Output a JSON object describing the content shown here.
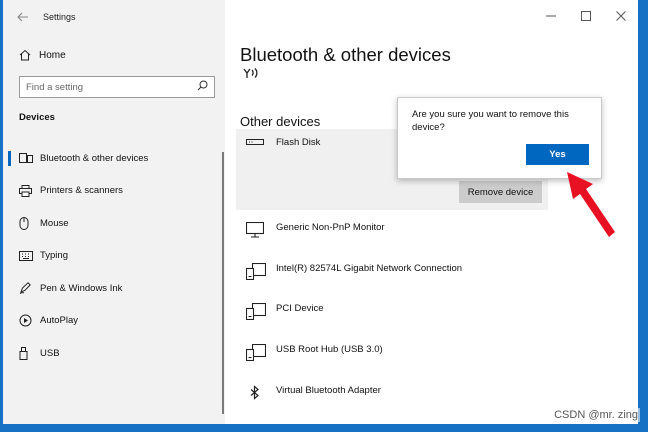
{
  "window": {
    "title": "Settings"
  },
  "sidebar": {
    "home_label": "Home",
    "search_placeholder": "Find a setting",
    "section_label": "Devices",
    "items": [
      {
        "label": "Bluetooth & other devices",
        "icon": "bluetooth-devices-icon",
        "active": true
      },
      {
        "label": "Printers & scanners",
        "icon": "printer-icon"
      },
      {
        "label": "Mouse",
        "icon": "mouse-icon"
      },
      {
        "label": "Typing",
        "icon": "keyboard-icon"
      },
      {
        "label": "Pen & Windows Ink",
        "icon": "pen-icon"
      },
      {
        "label": "AutoPlay",
        "icon": "autoplay-icon"
      },
      {
        "label": "USB",
        "icon": "usb-icon"
      }
    ]
  },
  "main": {
    "page_title": "Bluetooth & other devices",
    "group_title": "Other devices",
    "devices": [
      {
        "name": "Flash Disk",
        "icon": "flash-disk-icon"
      },
      {
        "name": "Generic Non-PnP Monitor",
        "icon": "monitor-icon"
      },
      {
        "name": "Intel(R) 82574L Gigabit Network Connection",
        "icon": "device-icon"
      },
      {
        "name": "PCI Device",
        "icon": "device-icon"
      },
      {
        "name": "USB Root Hub (USB 3.0)",
        "icon": "device-icon"
      },
      {
        "name": "Virtual Bluetooth Adapter",
        "icon": "bluetooth-icon"
      }
    ],
    "remove_button_label": "Remove device"
  },
  "confirm_flyout": {
    "message": "Are you sure you want to remove this device?",
    "yes_label": "Yes"
  },
  "annotation": {
    "arrow_color": "#e81123"
  },
  "watermark": "CSDN @mr. zing",
  "colors": {
    "accent": "#0067c0",
    "desktop": "#1671c4"
  }
}
